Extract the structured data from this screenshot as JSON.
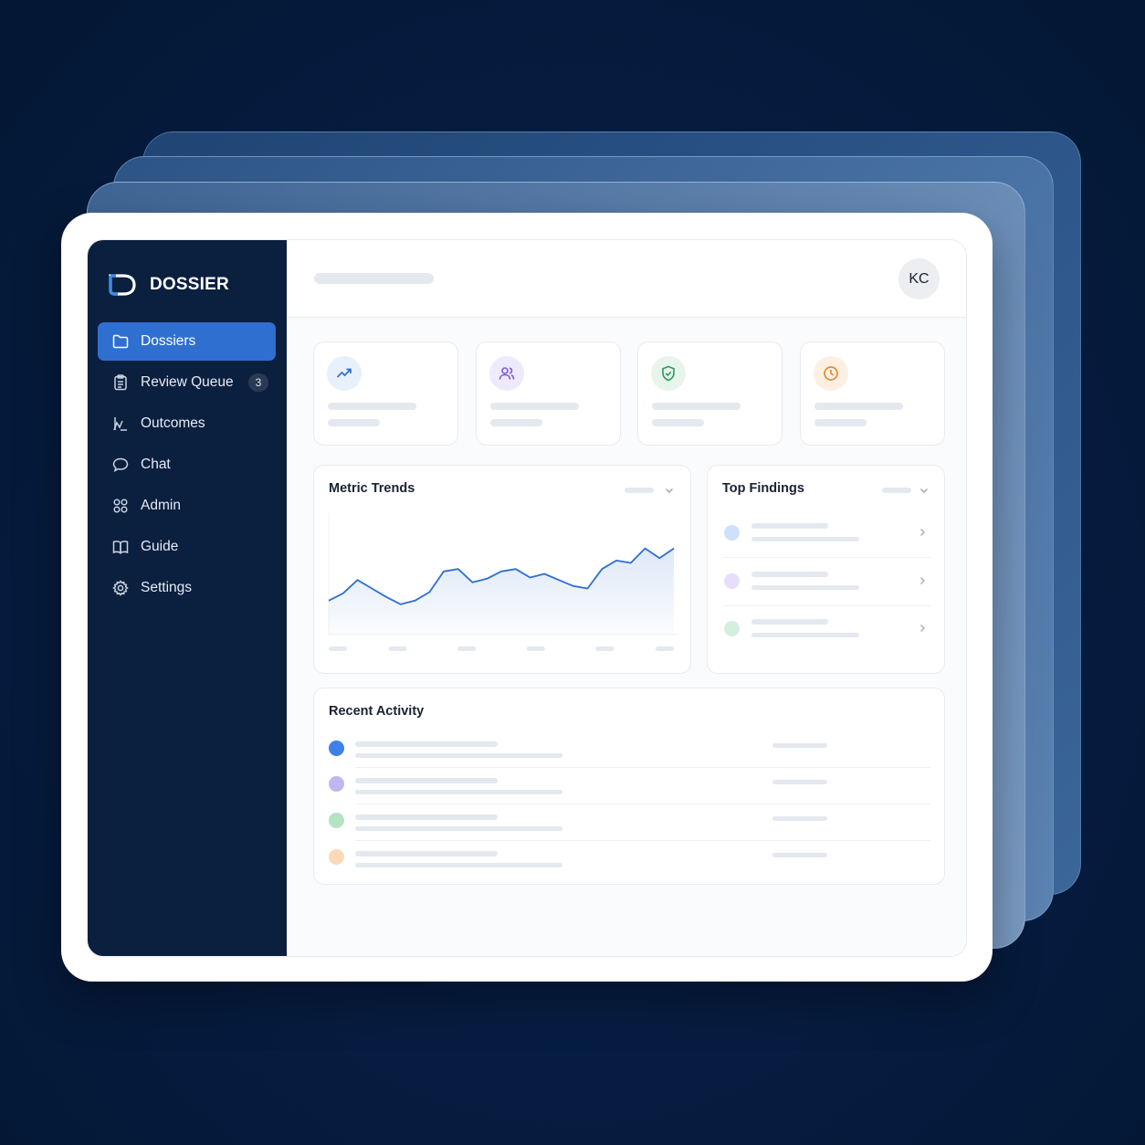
{
  "app": {
    "brand_name": "DOSSIER"
  },
  "sidebar": {
    "items": [
      {
        "label": "Dossiers",
        "icon": "folder-icon",
        "active": true
      },
      {
        "label": "Review Queue",
        "icon": "clipboard-icon",
        "badge": "3"
      },
      {
        "label": "Outcomes",
        "icon": "outcomes-chart-icon"
      },
      {
        "label": "Chat",
        "icon": "chat-bubble-icon"
      },
      {
        "label": "Admin",
        "icon": "admin-grid-icon"
      },
      {
        "label": "Guide",
        "icon": "book-icon"
      },
      {
        "label": "Settings",
        "icon": "gear-icon"
      }
    ]
  },
  "header": {
    "avatar_initials": "KC"
  },
  "stats": [
    {
      "icon": "trending-up-icon",
      "color": "#2f6fd0",
      "bg": "#e8f0fc"
    },
    {
      "icon": "users-icon",
      "color": "#7c5cd6",
      "bg": "#efeafb"
    },
    {
      "icon": "shield-check-icon",
      "color": "#2e9b58",
      "bg": "#e7f5ec"
    },
    {
      "icon": "clock-icon",
      "color": "#e5892f",
      "bg": "#fdf0e3"
    }
  ],
  "metric_trends": {
    "title": "Metric Trends"
  },
  "top_findings": {
    "title": "Top Findings",
    "dot_colors": [
      "#cfe0fb",
      "#e6defb",
      "#d3f0dc"
    ]
  },
  "recent_activity": {
    "title": "Recent Activity",
    "dot_colors": [
      "#3d82e8",
      "#c3b5f2",
      "#b5e3c3",
      "#fbd9b8"
    ]
  },
  "colors": {
    "accent": "#2f6fd0",
    "sidebar_bg": "#0b1f3f",
    "line": "#2f6fd0"
  },
  "chart_data": {
    "type": "area",
    "title": "",
    "xlabel": "",
    "ylabel": "",
    "x": [
      0,
      1,
      2,
      3,
      4,
      5,
      6,
      7,
      8,
      9,
      10,
      11,
      12,
      13,
      14,
      15,
      16,
      17,
      18,
      19,
      20,
      21,
      22,
      23,
      24
    ],
    "values": [
      28,
      34,
      45,
      38,
      31,
      25,
      28,
      35,
      52,
      54,
      43,
      46,
      52,
      54,
      47,
      50,
      45,
      40,
      38,
      54,
      61,
      59,
      71,
      63,
      71
    ],
    "ylim": [
      0,
      100
    ],
    "grid": false,
    "legend": "none"
  }
}
